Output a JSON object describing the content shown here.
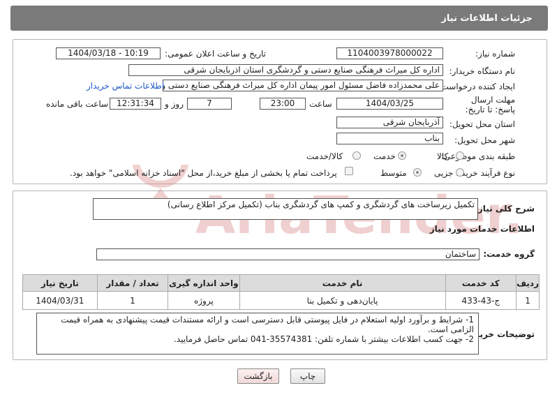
{
  "header": {
    "title": "جزئیات اطلاعات نیاز"
  },
  "form": {
    "need_number_label": "شماره نیاز:",
    "need_number": "1104003978000022",
    "announce_label": "تاریخ و ساعت اعلان عمومی:",
    "announce_value": "1404/03/18 - 10:19",
    "buyer_org_label": "نام دستگاه خریدار:",
    "buyer_org": "اداره کل میراث فرهنگی  صنایع دستی و گردشگری استان اذربایجان شرقی",
    "creator_label": "ایجاد کننده درخواست:",
    "creator": "علی محمدزاده فاضل مسئول امور پیمان اداره کل میراث فرهنگی  صنایع دستی و",
    "contact_link": "اطلاعات تماس خریدار",
    "deadline_label": "مهلت ارسال پاسخ: تا تاریخ:",
    "deadline_date": "1404/03/25",
    "time_label": "ساعت",
    "deadline_time": "23:00",
    "days_value": "7",
    "days_label": "روز و",
    "remaining_time": "12:31:34",
    "remaining_label": "ساعت باقی مانده",
    "province_label": "استان محل تحویل:",
    "province": "آذربایجان شرقی",
    "city_label": "شهر محل تحویل:",
    "city": "بناب",
    "category_label": "طبقه بندی موضوعی:",
    "category_options": [
      "کالا",
      "خدمت",
      "کالا/خدمت"
    ],
    "category_selected": "خدمت",
    "process_label": "نوع فرآیند خرید :",
    "process_options": [
      "جزیی",
      "متوسط"
    ],
    "process_selected": "متوسط",
    "treasury_text": "پرداخت تمام یا بخشی از مبلغ خرید،از محل \"اسناد خزانه اسلامی\" خواهد بود."
  },
  "need": {
    "desc_label": "شرح کلی نیاز:",
    "desc": "تکمیل زیرساخت های گردشگری و کمپ های گردشگری بناب (تکمیل مرکز اطلاع رسانی)",
    "services_title": "اطلاعات خدمات مورد نیاز",
    "group_label": "گروه خدمت:",
    "group": "ساختمان"
  },
  "table": {
    "headers": [
      "ردیف",
      "کد خدمت",
      "نام خدمت",
      "واحد اندازه گیری",
      "تعداد / مقدار",
      "تاریخ نیاز"
    ],
    "rows": [
      [
        "1",
        "ج-43-433",
        "پایان‌دهی و تکمیل بنا",
        "پروژه",
        "1",
        "1404/03/31"
      ]
    ]
  },
  "notes": {
    "label": "توضیحات خریدار:",
    "line1": "1- شرایط و برآورد اولیه استعلام در فایل پیوستی قابل دسترسی است و ارائه مستندات قیمت پیشنهادی به همراه قیمت الزامی است.",
    "line2": "2- جهت کسب اطلاعات بیشتر  با شماره تلفن: 35574381-041  تماس حاصل فرمایید."
  },
  "buttons": {
    "print": "چاپ",
    "back": "بازگشت"
  },
  "watermark": {
    "text": "AriaTender.net"
  },
  "colors": {
    "header_bg": "#7a7a7a",
    "link": "#1d57c9",
    "watermark": "#e3a9a9"
  }
}
